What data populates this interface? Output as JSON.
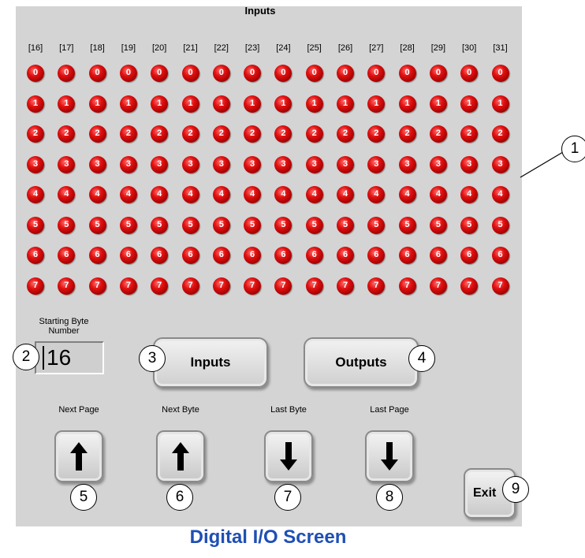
{
  "window": {
    "title": "Inputs",
    "caption": "Digital I/O Screen"
  },
  "grid": {
    "columns": [
      "[16]",
      "[17]",
      "[18]",
      "[19]",
      "[20]",
      "[21]",
      "[22]",
      "[23]",
      "[24]",
      "[25]",
      "[26]",
      "[27]",
      "[28]",
      "[29]",
      "[30]",
      "[31]"
    ],
    "bits": [
      "0",
      "1",
      "2",
      "3",
      "4",
      "5",
      "6",
      "7"
    ],
    "led_color": "#d10000"
  },
  "starting_byte": {
    "label": "Starting Byte Number",
    "value": "16"
  },
  "mode_buttons": {
    "inputs_label": "Inputs",
    "outputs_label": "Outputs"
  },
  "nav": {
    "next_page_label": "Next Page",
    "next_byte_label": "Next Byte",
    "last_byte_label": "Last Byte",
    "last_page_label": "Last Page",
    "next_page_icon": "arrow-up-icon",
    "next_byte_icon": "arrow-up-icon",
    "last_byte_icon": "arrow-down-icon",
    "last_page_icon": "arrow-down-icon"
  },
  "exit_label": "Exit",
  "callouts": {
    "c1": "1",
    "c2": "2",
    "c3": "3",
    "c4": "4",
    "c5": "5",
    "c6": "6",
    "c7": "7",
    "c8": "8",
    "c9": "9"
  }
}
